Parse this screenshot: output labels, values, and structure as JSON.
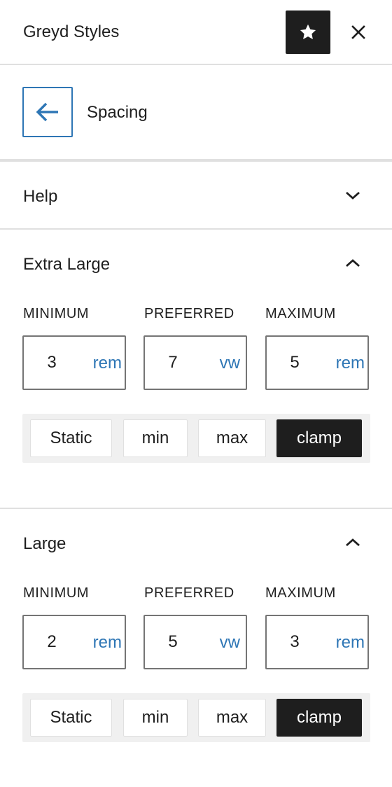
{
  "header": {
    "title": "Greyd Styles",
    "star_icon": "star-icon",
    "close_icon": "close-icon"
  },
  "nav": {
    "back_icon": "arrow-left-icon",
    "title": "Spacing"
  },
  "panels": [
    {
      "title": "Help",
      "expanded": false
    },
    {
      "title": "Extra Large",
      "expanded": true,
      "labels": {
        "min": "MINIMUM",
        "pref": "PREFERRED",
        "max": "MAXIMUM"
      },
      "min": {
        "value": "3",
        "unit": "rem"
      },
      "pref": {
        "value": "7",
        "unit": "vw"
      },
      "max": {
        "value": "5",
        "unit": "rem"
      },
      "modes": [
        "Static",
        "min",
        "max",
        "clamp"
      ],
      "active_mode": "clamp"
    },
    {
      "title": "Large",
      "expanded": true,
      "labels": {
        "min": "MINIMUM",
        "pref": "PREFERRED",
        "max": "MAXIMUM"
      },
      "min": {
        "value": "2",
        "unit": "rem"
      },
      "pref": {
        "value": "5",
        "unit": "vw"
      },
      "max": {
        "value": "3",
        "unit": "rem"
      },
      "modes": [
        "Static",
        "min",
        "max",
        "clamp"
      ],
      "active_mode": "clamp"
    }
  ],
  "colors": {
    "accent": "#2e76b5",
    "dark": "#1e1e1e",
    "border": "#e0e0e0",
    "segment_bg": "#f0f0f0"
  }
}
